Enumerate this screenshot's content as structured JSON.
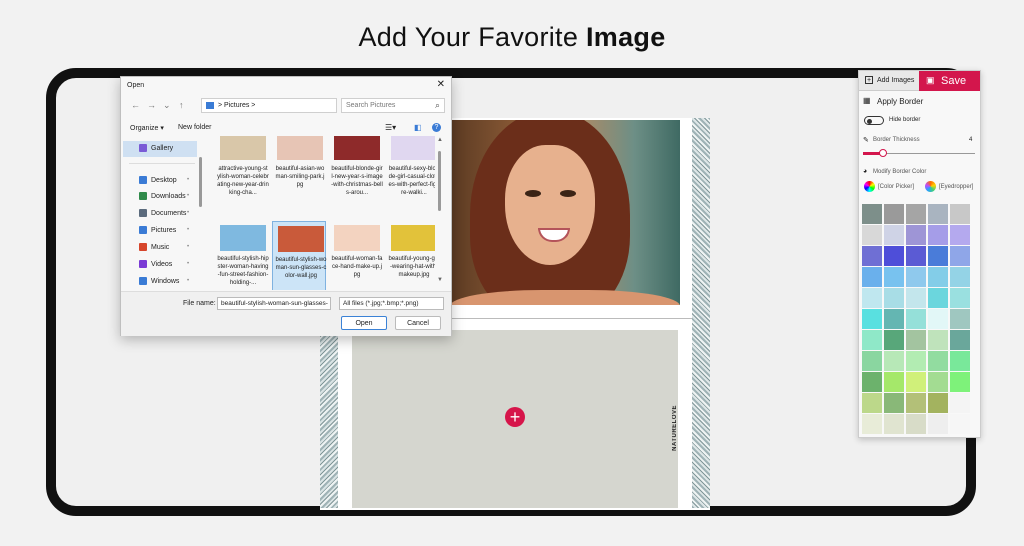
{
  "headline": {
    "prefix": "Add Your Favorite",
    "bold": "Image"
  },
  "canvas": {
    "add_symbol": "+",
    "brand_vertical": "NATURELOVE"
  },
  "dialog": {
    "title": "Open",
    "close": "✕",
    "nav": {
      "back": "←",
      "forward": "→",
      "down": "⌄",
      "up": "↑"
    },
    "address": {
      "sep": ">",
      "location": "Pictures",
      "drop": "⌄",
      "refresh": "↻"
    },
    "search_placeholder": "Search Pictures",
    "toolbar": {
      "organize": "Organize ▾",
      "new_folder": "New folder"
    },
    "sidebar": [
      {
        "label": "Gallery",
        "color": "#7a5bd6",
        "pinned": false,
        "selected": true
      },
      {
        "label": "Desktop",
        "color": "#3a7bd5",
        "pinned": true,
        "selected": false
      },
      {
        "label": "Downloads",
        "color": "#2f8a4a",
        "pinned": true,
        "selected": false
      },
      {
        "label": "Documents",
        "color": "#5b6b7d",
        "pinned": true,
        "selected": false
      },
      {
        "label": "Pictures",
        "color": "#3a7bd5",
        "pinned": true,
        "selected": false
      },
      {
        "label": "Music",
        "color": "#d6452b",
        "pinned": true,
        "selected": false
      },
      {
        "label": "Videos",
        "color": "#7a3bd5",
        "pinned": true,
        "selected": false
      },
      {
        "label": "Windows",
        "color": "#3a7bd5",
        "pinned": true,
        "selected": false
      }
    ],
    "files_top_row": [
      {
        "thumb": "#d9c7a9"
      },
      {
        "thumb": "#e7c5b5"
      },
      {
        "thumb": "#8e2a2a"
      },
      {
        "thumb": "#e0d7f0"
      }
    ],
    "files": [
      {
        "name": "attractive-young-stylish-woman-celebrating-new-year-drinking-cha...",
        "thumb": "#e8e2d7",
        "selected": false
      },
      {
        "name": "beautiful-asian-woman-smiling-park.jpg",
        "thumb": "#e0d0c0",
        "selected": false
      },
      {
        "name": "beautiful-blonde-girl-new-year-s-image-with-christmas-bells-arou...",
        "thumb": "#7a1f1f",
        "selected": false
      },
      {
        "name": "beautiful-sexy-blonde-girl-casual-clothes-with-perfect-figure-walki...",
        "thumb": "#d2d2d2",
        "selected": false
      },
      {
        "name": "beautiful-stylish-hipster-woman-having-fun-street-fashion-holding-...",
        "thumb": "#7fb9e0",
        "selected": false
      },
      {
        "name": "beautiful-stylish-woman-sun-glasses-color-wall.jpg",
        "thumb": "#c95a3a",
        "selected": true
      },
      {
        "name": "beautiful-woman-face-hand-make-up.jpg",
        "thumb": "#f3d3c0",
        "selected": false
      },
      {
        "name": "beautiful-young-girl-wearing-hat-with-makeup.jpg",
        "thumb": "#e2c23a",
        "selected": false
      }
    ],
    "file_name_label": "File name:",
    "file_name_value": "beautiful-stylish-woman-sun-glasses-",
    "file_type_value": "All files (*.jpg;*.bmp;*.png)",
    "open_label": "Open",
    "cancel_label": "Cancel"
  },
  "panel": {
    "add_images_label": "Add Images",
    "save_label": "Save",
    "apply_border_label": "Apply Border",
    "hide_border_label": "Hide border",
    "border_thickness_label": "Border Thickness",
    "border_thickness_value": "4",
    "border_thickness_fraction": 0.18,
    "modify_color_label": "Modify Border Color",
    "color_picker_label": "[Color Picker]",
    "eyedropper_label": "[Eyedropper]",
    "accent": "#d3164c",
    "palette": [
      [
        "#7d8f8a",
        "#9a9a9a",
        "#a5a5a5",
        "#a9b4c0",
        "#c8c8c8"
      ],
      [
        "#d8d8d8",
        "#cfd3e6",
        "#9e95d6",
        "#a59de8",
        "#b4a9ee"
      ],
      [
        "#6f6fd4",
        "#4e4ed9",
        "#5b5bd4",
        "#4a7cd9",
        "#8fa6e8"
      ],
      [
        "#6ab0ec",
        "#78c2ef",
        "#8fc9ed",
        "#83cde8",
        "#94d3e6"
      ],
      [
        "#bfe7ef",
        "#a8dde6",
        "#c3e6ec",
        "#6bd6dd",
        "#9ae0e0"
      ],
      [
        "#59e0e0",
        "#64b6b2",
        "#95e0d9",
        "#e2f7f7",
        "#9fc7c0"
      ],
      [
        "#8fe8c8",
        "#58a77a",
        "#a3c4a0",
        "#bfe3bb",
        "#6aa79b"
      ],
      [
        "#8ad6a0",
        "#b7e8b7",
        "#b2ecb2",
        "#92dca0",
        "#79e89a"
      ],
      [
        "#6cb26c",
        "#a5e86a",
        "#d0f07a",
        "#a3dc92",
        "#7ef27a"
      ],
      [
        "#bcd88a",
        "#89b878",
        "#b3c078",
        "#a3b35f",
        "#f4f4f4"
      ],
      [
        "#e8ecd8",
        "#e0e4d0",
        "#d8dcc8",
        "#eeeeee",
        "#f6f6f6"
      ]
    ]
  }
}
